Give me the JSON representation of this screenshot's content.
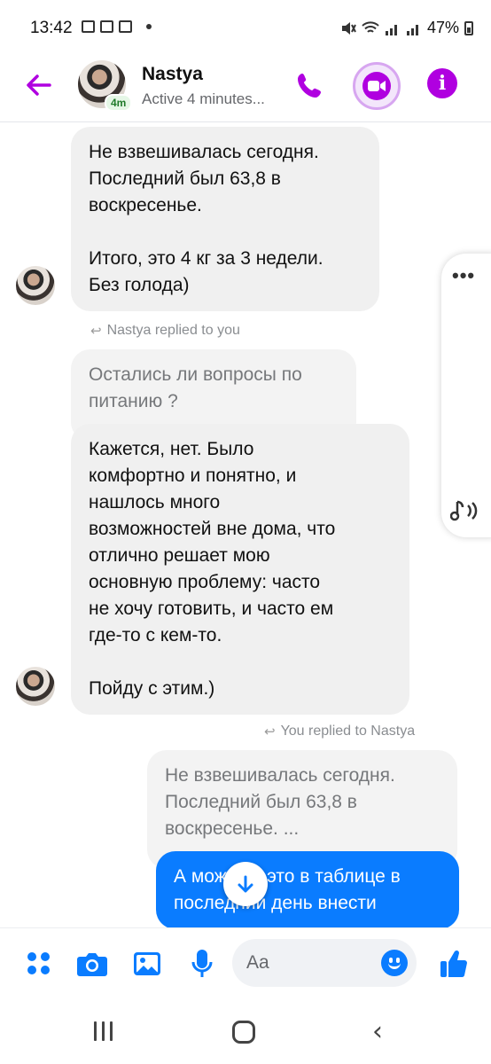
{
  "status_bar": {
    "time": "13:42",
    "battery": "47%"
  },
  "header": {
    "contact_name": "Nastya",
    "contact_status": "Active 4 minutes...",
    "presence_badge": "4m",
    "icons": [
      "back-arrow-icon",
      "phone-icon",
      "video-camera-icon",
      "info-icon"
    ],
    "accent_color": "#b000e0"
  },
  "messages": [
    {
      "type": "received",
      "text": "Не взвешивалась сегодня.\nПоследний был 63,8 в\nвоскресенье.\n\nИтого, это 4 кг за 3 недели.\nБез голода)"
    },
    {
      "type": "reply_note",
      "text": "Nastya replied to you"
    },
    {
      "type": "quoted",
      "text": "Остались ли вопросы по\nпитанию ?"
    },
    {
      "type": "received",
      "text": "Кажется, нет. Было\nкомфортно и понятно, и\nнашлось много\nвозможностей вне дома, что\nотлично решает мою\nосновную проблему: часто\nне хочу готовить, и часто ем\nгде-то с кем-то.\n\nПойду с этим.)"
    },
    {
      "type": "reply_note",
      "text": "You replied to Nastya"
    },
    {
      "type": "quoted",
      "text": "Не взвешивалась сегодня.\nПоследний был 63,8 в\nвоскресенье. ..."
    },
    {
      "type": "sent",
      "text": "А можешь это в таблице в\nпоследний день внести"
    }
  ],
  "composer": {
    "placeholder": "Aa",
    "icons": [
      "apps-grid-icon",
      "camera-icon",
      "gallery-icon",
      "microphone-icon",
      "emoji-icon",
      "thumbs-up-icon"
    ],
    "accent_color": "#0a7cff"
  },
  "side_panel": {
    "icons": [
      "more-icon",
      "audio-icon"
    ]
  }
}
